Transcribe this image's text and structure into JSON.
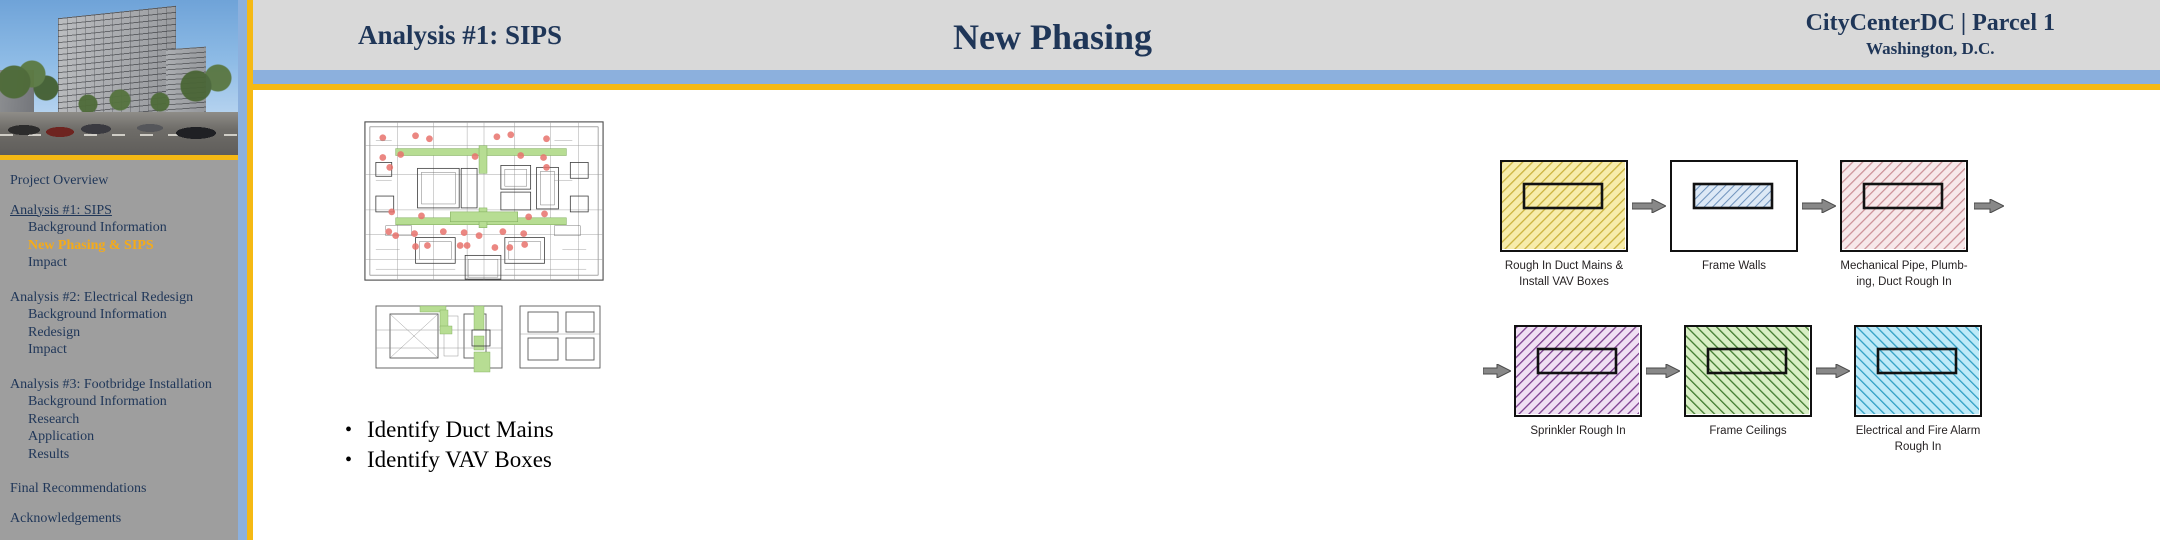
{
  "header": {
    "title_left": "Analysis #1: SIPS",
    "title_center": "New Phasing",
    "project_name": "CityCenterDC | Parcel 1",
    "project_location": "Washington, D.C.",
    "accent_gold": "#f5b914",
    "accent_blue": "#8cb0dd",
    "title_color": "#1f3658",
    "bar_gray": "#d9d9d9"
  },
  "sidebar": {
    "background": "#9e9e9e",
    "active_color": "#f5ab18",
    "text_color": "#1f3658",
    "items": [
      {
        "label": "Project Overview",
        "level": 0,
        "state": "normal"
      },
      {
        "label": "Analysis #1: SIPS",
        "level": 0,
        "state": "underline"
      },
      {
        "label": "Background Information",
        "level": 1,
        "state": "normal"
      },
      {
        "label": "New Phasing & SIPS",
        "level": 1,
        "state": "active"
      },
      {
        "label": "Impact",
        "level": 1,
        "state": "normal"
      },
      {
        "label": "Analysis #2: Electrical  Redesign",
        "level": 0,
        "state": "normal"
      },
      {
        "label": "Background Information",
        "level": 1,
        "state": "normal"
      },
      {
        "label": "Redesign",
        "level": 1,
        "state": "normal"
      },
      {
        "label": "Impact",
        "level": 1,
        "state": "normal"
      },
      {
        "label": "Analysis #3: Footbridge Installation",
        "level": 0,
        "state": "normal"
      },
      {
        "label": "Background Information",
        "level": 1,
        "state": "normal"
      },
      {
        "label": "Research",
        "level": 1,
        "state": "normal"
      },
      {
        "label": "Application",
        "level": 1,
        "state": "normal"
      },
      {
        "label": "Results",
        "level": 1,
        "state": "normal"
      },
      {
        "label": "Final Recommendations",
        "level": 0,
        "state": "normal"
      },
      {
        "label": "Acknowledgements",
        "level": 0,
        "state": "normal"
      }
    ],
    "photo_alt": "CityCenterDC building rendering"
  },
  "main": {
    "bullets": [
      {
        "marker": "•",
        "text": "Identify Duct Mains"
      },
      {
        "marker": "•",
        "text": "Identify VAV Boxes"
      }
    ],
    "floorplan_upper_alt": "Typical floor plan with duct mains highlighted green and VAV boxes marked red",
    "floorplan_lower_alt": "Partial floor plan with duct mains highlighted green"
  },
  "chart_data": {
    "type": "diagram",
    "title": "New Phasing",
    "description": "Sequential SIPS phase sequence of six construction activities connected by arrows",
    "rows": [
      {
        "row": 1,
        "lead_arrow": false,
        "trailing_arrow": true,
        "cells": [
          {
            "label": "Rough In Duct Mains & Install VAV Boxes",
            "fill": "#f3e27a",
            "hatch": "#c9b23c",
            "hatch_direction": "forward",
            "inner_fill": "none",
            "inner_hatch": "none"
          },
          {
            "label": "Frame Walls",
            "fill": "#ffffff",
            "hatch": "none",
            "hatch_direction": "none",
            "inner_fill": "#cfe0f2",
            "inner_hatch": "#6f93bd"
          },
          {
            "label": "Mechanical Pipe, Plumb-ing, Duct Rough In",
            "fill": "#f0dcdf",
            "hatch": "#c98e95",
            "hatch_direction": "forward",
            "inner_fill": "none",
            "inner_hatch": "none"
          }
        ]
      },
      {
        "row": 2,
        "lead_arrow": true,
        "trailing_arrow": false,
        "cells": [
          {
            "label": "Sprinkler Rough In",
            "fill": "#e9d3ec",
            "hatch": "#7b3d8f",
            "hatch_direction": "forward",
            "inner_fill": "none",
            "inner_hatch": "none"
          },
          {
            "label": "Frame Ceilings",
            "fill": "#cfe8b9",
            "hatch": "#3f7a2e",
            "hatch_direction": "backward",
            "inner_fill": "none",
            "inner_hatch": "none"
          },
          {
            "label": "Electrical and Fire Alarm Rough In",
            "fill": "#a9e3f5",
            "hatch": "#2f9fc4",
            "hatch_direction": "backward",
            "inner_fill": "none",
            "inner_hatch": "none"
          }
        ]
      }
    ],
    "arrow_color": "#6f6f6f",
    "box_border_color": "#111111"
  }
}
